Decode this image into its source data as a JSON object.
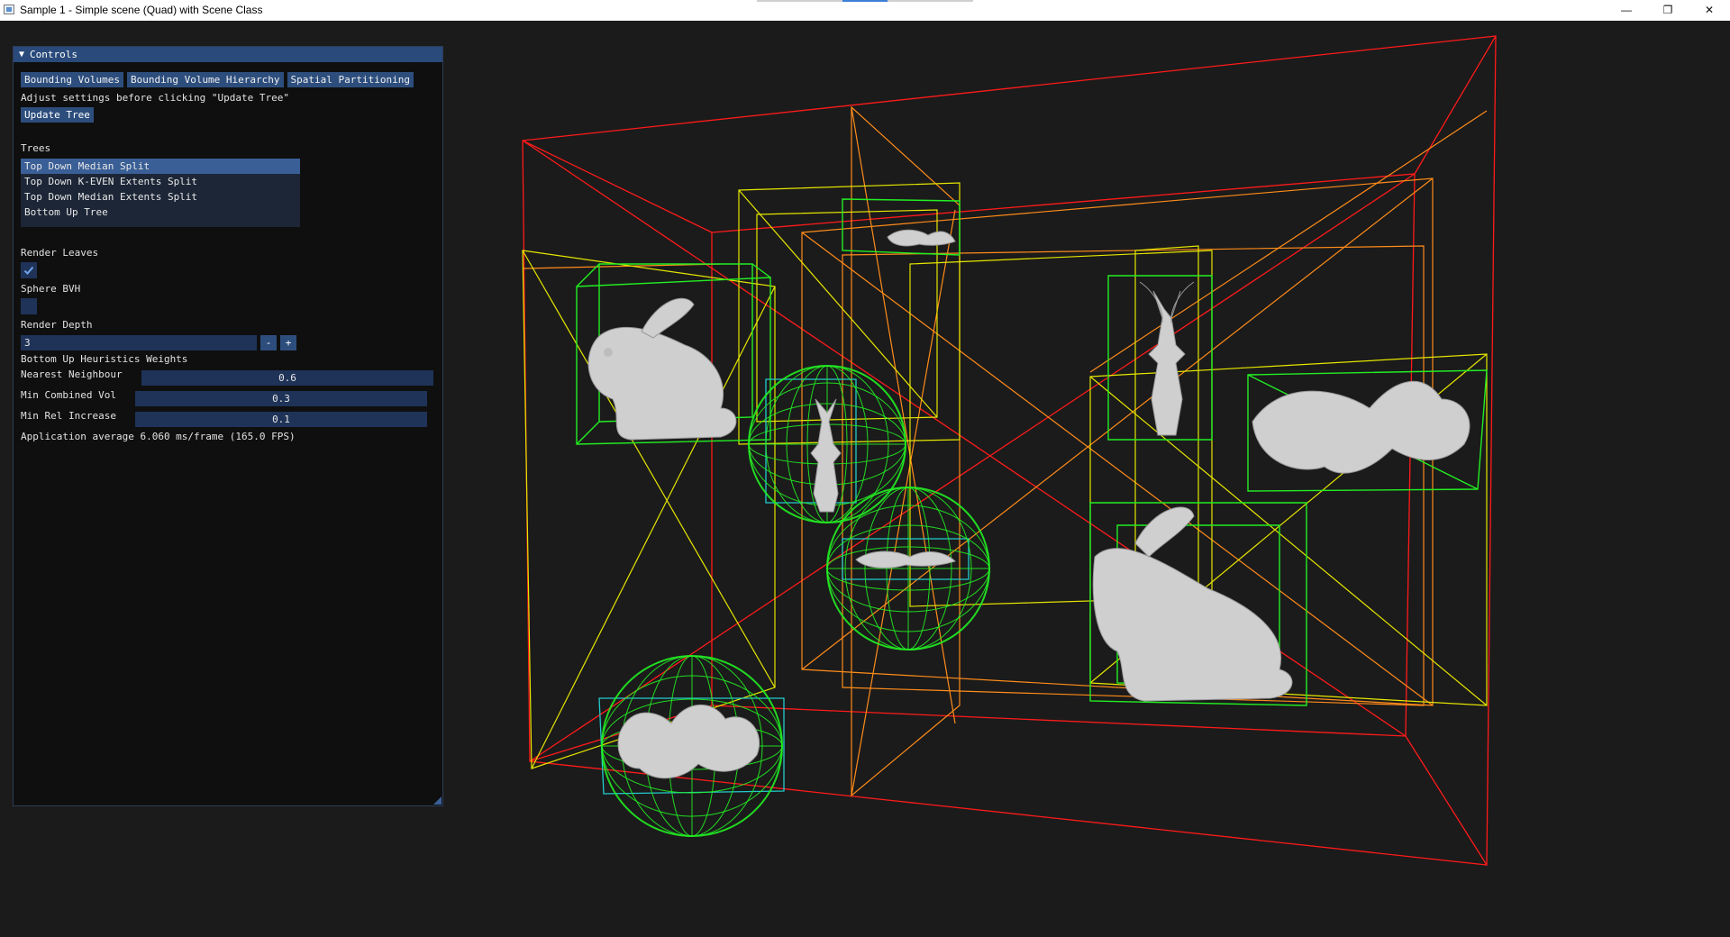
{
  "window": {
    "title": "Sample 1 - Simple scene (Quad) with Scene Class",
    "min_symbol": "—",
    "max_symbol": "❐",
    "close_symbol": "✕"
  },
  "controls": {
    "header": "Controls",
    "tabs": [
      "Bounding Volumes",
      "Bounding Volume Hierarchy",
      "Spatial Partitioning"
    ],
    "instruction": "Adjust settings before clicking \"Update Tree\"",
    "update_button": "Update Tree",
    "trees_label": "Trees",
    "trees": [
      "Top Down Median Split",
      "Top Down K-EVEN Extents Split",
      "Top Down Median Extents Split",
      "Bottom Up Tree"
    ],
    "selected_tree": "Top Down Median Split",
    "render_leaves_label": "Render Leaves",
    "render_leaves_checked": true,
    "sphere_bvh_label": "Sphere BVH",
    "sphere_bvh_checked": false,
    "render_depth_label": "Render Depth",
    "render_depth_value": "3",
    "minus": "-",
    "plus": "+",
    "heuristics_label": "Bottom Up Heuristics Weights",
    "nearest_neighbour_label": "Nearest Neighbour",
    "nearest_neighbour_value": "0.6",
    "min_combined_vol_label": "Min Combined Vol",
    "min_combined_vol_value": "0.3",
    "min_rel_increase_label": "Min Rel Increase",
    "min_rel_increase_value": "0.1",
    "fps_text": "Application average 6.060 ms/frame (165.0 FPS)"
  },
  "colors": {
    "level0": "#ff1a1a",
    "level1": "#ff8c1a",
    "level2": "#e6e600",
    "leaf": "#22ee22",
    "aabb_leaf": "#22cccc",
    "panel_header": "#294a7a",
    "tab": "#2d4e7d"
  },
  "icons": {
    "check": "checkmark-icon",
    "collapse": "triangle-down-icon"
  }
}
